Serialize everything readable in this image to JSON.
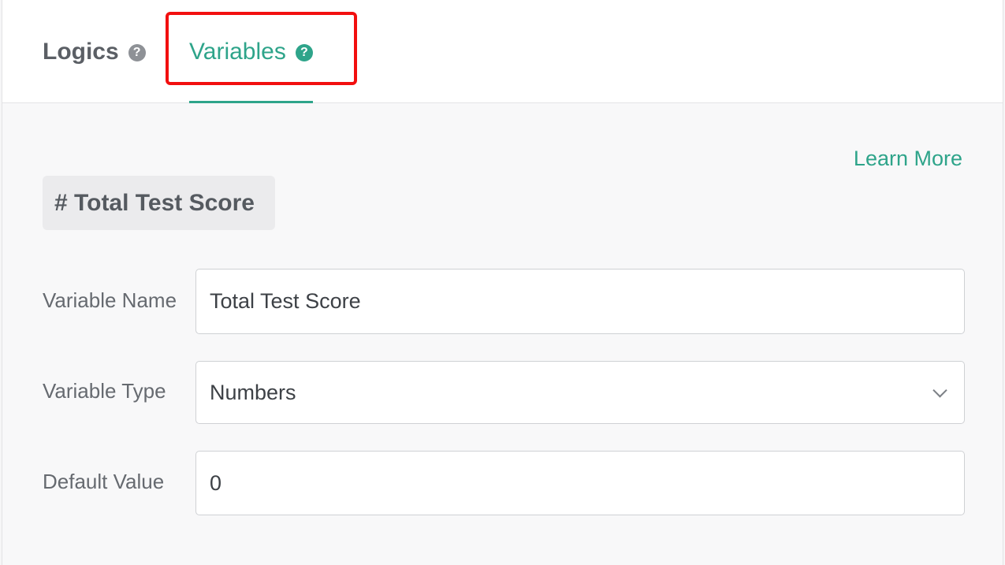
{
  "tabs": {
    "logics_label": "Logics",
    "variables_label": "Variables",
    "help_glyph": "?"
  },
  "learn_more": "Learn More",
  "variable_chip": "# Total Test Score",
  "form": {
    "variable_name": {
      "label": "Variable Name",
      "value": "Total Test Score"
    },
    "variable_type": {
      "label": "Variable Type",
      "value": "Numbers"
    },
    "default_value": {
      "label": "Default Value",
      "value": "0"
    }
  },
  "colors": {
    "accent": "#2ea48a",
    "highlight": "#f20f0f",
    "chip_bg": "#ebebed"
  },
  "icons": [
    "question-circle-icon",
    "chevron-down-icon"
  ]
}
